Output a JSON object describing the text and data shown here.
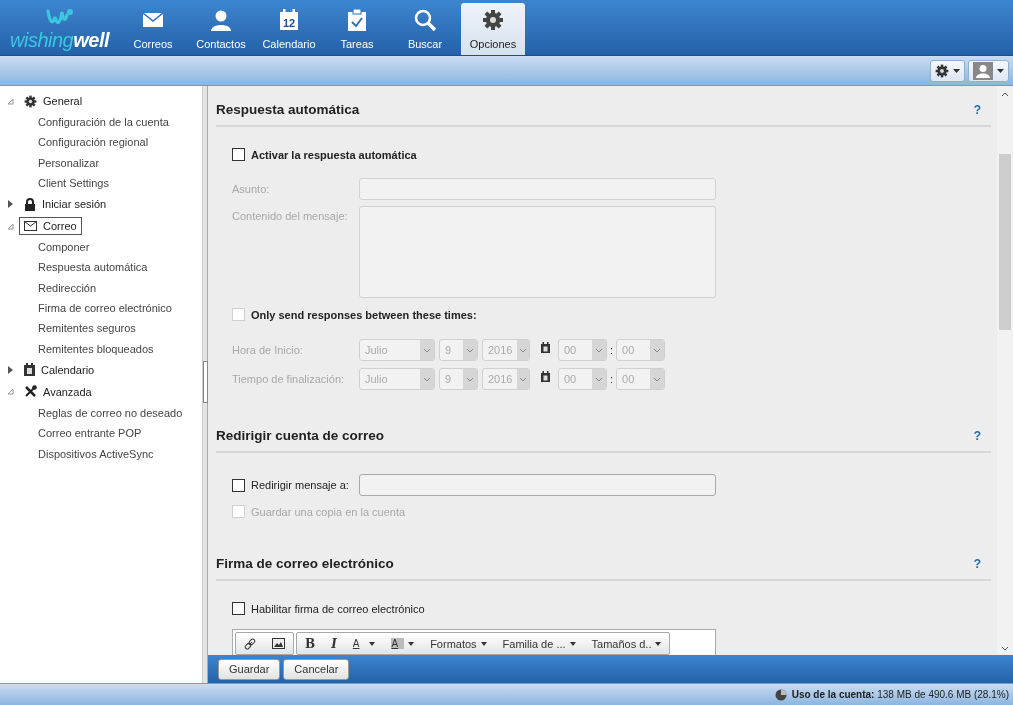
{
  "logo": {
    "words": [
      "wishing",
      "well"
    ]
  },
  "nav": [
    {
      "label": "Correos",
      "selected": false
    },
    {
      "label": "Contactos",
      "selected": false
    },
    {
      "label": "Calendario",
      "selected": false,
      "icon_text": "12"
    },
    {
      "label": "Tareas",
      "selected": false
    },
    {
      "label": "Buscar",
      "selected": false
    },
    {
      "label": "Opciones",
      "selected": true
    }
  ],
  "sidebar": [
    {
      "label": "General",
      "expanded": true,
      "selected": false,
      "children": [
        {
          "label": "Configuración de la cuenta",
          "selected": false
        },
        {
          "label": "Configuración regional",
          "selected": false
        },
        {
          "label": "Personalizar",
          "selected": false
        },
        {
          "label": "Client Settings",
          "selected": false
        }
      ]
    },
    {
      "label": "Iniciar sesión",
      "expanded": false,
      "selected": false
    },
    {
      "label": "Correo",
      "expanded": true,
      "selected": true,
      "children": [
        {
          "label": "Componer",
          "selected": false
        },
        {
          "label": "Respuesta automática",
          "selected": false
        },
        {
          "label": "Redirección",
          "selected": false
        },
        {
          "label": "Firma de correo electrónico",
          "selected": false
        },
        {
          "label": "Remitentes seguros",
          "selected": false
        },
        {
          "label": "Remitentes bloqueados",
          "selected": false
        }
      ]
    },
    {
      "label": "Calendario",
      "expanded": false,
      "selected": false
    },
    {
      "label": "Avanzada",
      "expanded": true,
      "selected": false,
      "children": [
        {
          "label": "Reglas de correo no deseado",
          "selected": false
        },
        {
          "label": "Correo entrante POP",
          "selected": false
        },
        {
          "label": "Dispositivos ActiveSync",
          "selected": false
        }
      ]
    }
  ],
  "sections": [
    {
      "title": "Respuesta automática",
      "help": "?",
      "rows": [
        {
          "kind": "checkbox",
          "label": "Activar la respuesta automática",
          "checked": false,
          "disabled": false,
          "bold": true
        },
        {
          "kind": "field",
          "label": "Asunto:",
          "disabled": true
        },
        {
          "kind": "textarea",
          "label": "Contenido del mensaje:",
          "disabled": true
        },
        {
          "kind": "checkbox",
          "label": "Only send responses between these times:",
          "checked": false,
          "disabled": true,
          "bold": true
        },
        {
          "kind": "time",
          "label": "Hora de Inicio:",
          "month": "Julio",
          "day": "9",
          "year": "2016",
          "hour": "00",
          "separator": ":",
          "minute": "00",
          "disabled": true
        },
        {
          "kind": "time",
          "label": "Tiempo de finalización:",
          "month": "Julio",
          "day": "9",
          "year": "2016",
          "hour": "00",
          "separator": ":",
          "minute": "00",
          "disabled": true
        }
      ]
    },
    {
      "title": "Redirigir cuenta de correo",
      "help": "?",
      "rows": [
        {
          "kind": "checkfield",
          "label": "Redirigir mensaje a:",
          "checked": false,
          "disabled": false
        },
        {
          "kind": "checkbox",
          "label": "Guardar una copia en la cuenta",
          "checked": false,
          "disabled": true,
          "bold": false
        }
      ]
    },
    {
      "title": "Firma de correo electrónico",
      "help": "?",
      "rows": [
        {
          "kind": "checkbox",
          "label": "Habilitar firma de correo electrónico",
          "checked": false,
          "disabled": false,
          "bold": false
        },
        {
          "kind": "editor",
          "groups": [
            [
              {
                "kind": "link"
              },
              {
                "kind": "image"
              }
            ],
            [
              {
                "kind": "bold",
                "label": "B"
              },
              {
                "kind": "italic",
                "label": "I"
              },
              {
                "kind": "color",
                "label": "A"
              },
              {
                "kind": "highlight",
                "label": "A"
              },
              {
                "kind": "menu",
                "label": "Formatos"
              },
              {
                "kind": "menu",
                "label": "Familia de ..."
              },
              {
                "kind": "menu",
                "label": "Tamaños d.."
              }
            ]
          ]
        }
      ]
    }
  ],
  "footer_buttons": [
    "Guardar",
    "Cancelar"
  ],
  "status": "**Uso de la cuenta:** 138 MB de 490.6 MB (28.1%)"
}
